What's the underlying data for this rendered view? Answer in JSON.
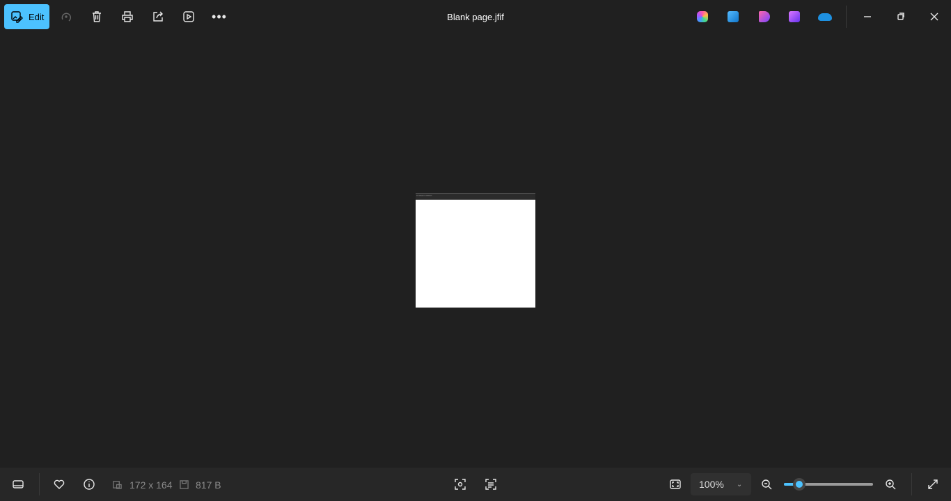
{
  "toolbar": {
    "edit_label": "Edit",
    "title": "Blank page.jfif"
  },
  "image": {
    "header_text": "DTREECOMBAT"
  },
  "status": {
    "dimensions": "172 x 164",
    "file_size": "817 B"
  },
  "zoom": {
    "level": "100%",
    "slider_fraction": 0.17
  },
  "colors": {
    "accent": "#4cc2ff",
    "background": "#202020"
  }
}
